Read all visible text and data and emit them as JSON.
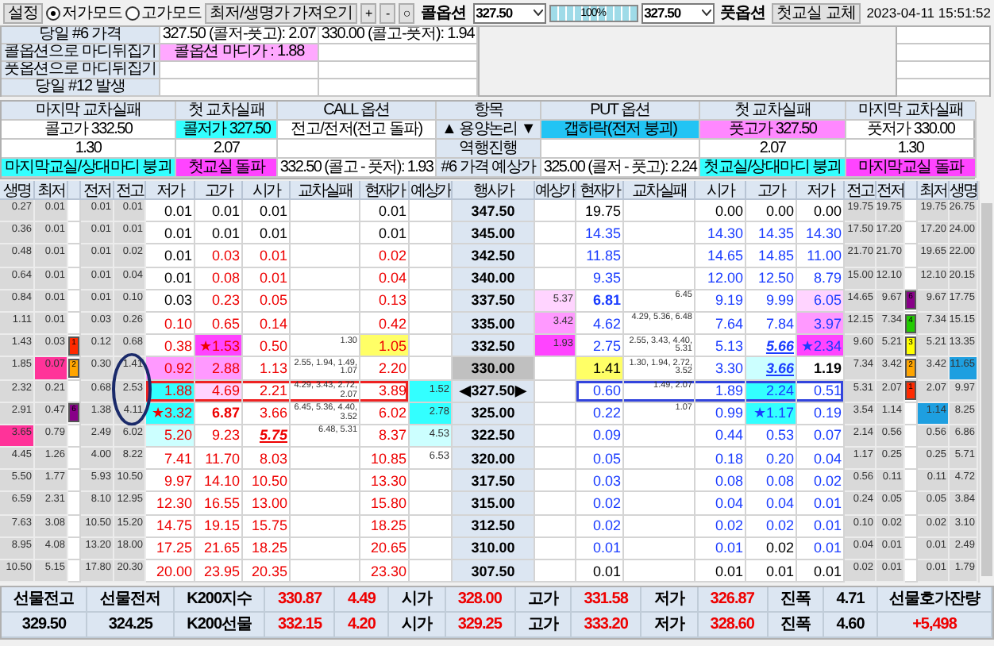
{
  "toolbar": {
    "settings_button": "설정",
    "modes": [
      {
        "label": "저가모드",
        "selected": true
      },
      {
        "label": "고가모드",
        "selected": false
      }
    ],
    "fetch_button": "최저/생명가 가져오기",
    "small_buttons": [
      "+",
      "-",
      "○"
    ],
    "call_label": "콜옵션",
    "call_select": "327.50",
    "progress": {
      "label": "100%",
      "level": 1.0
    },
    "put_select": "327.50",
    "put_label": "풋옵션",
    "swap_button": "첫교실 교체",
    "datetime": "2023-04-11 15:51:52"
  },
  "info": {
    "rows": [
      [
        "당일 #6 가격",
        "327.50 (콜저-풋고): 2.07",
        "330.00 (콜고-풋저): 1.94"
      ],
      [
        "콜옵션으로 마디뒤집기",
        {
          "text": "콜옵션 마디가 : 1.88",
          "color": "#ffa8ff"
        },
        null
      ],
      [
        "풋옵션으로 마디뒤집기",
        null,
        null
      ],
      [
        "당일 #12 발생",
        null,
        null
      ]
    ]
  },
  "summary": {
    "headers": [
      "마지막 교차실패",
      "첫 교차실패",
      "CALL 옵션",
      "항목",
      "PUT 옵션",
      "첫 교차실패",
      "마지막 교차실패"
    ],
    "rows": [
      [
        "콜고가 332.50",
        {
          "text": "콜저가 327.50",
          "color": "#33ffff"
        },
        "전고/전저(전고 돌파)",
        "▲ 용양논리 ▼",
        {
          "text": "갭하락(전저 붕괴)",
          "color": "#22c4f4"
        },
        {
          "text": "풋고가 327.50",
          "color": "#ff88ff"
        },
        "풋저가 330.00"
      ],
      [
        "1.30",
        "2.07",
        null,
        "역행진행",
        null,
        "2.07",
        "1.30"
      ],
      [
        {
          "text": "마지막교실/상대마디 붕괴",
          "color": "#33ffff"
        },
        {
          "text": "첫교실 돌파",
          "color": "#ff44ff"
        },
        "332.50 (콜고 - 풋저): 1.93",
        "#6 가격 예상가",
        "325.00 (콜저 - 풋고): 2.24",
        {
          "text": "첫교실/상대마디 붕괴",
          "color": "#33ffff"
        },
        {
          "text": "마지막교실 돌파",
          "color": "#ff44ff"
        }
      ]
    ]
  },
  "table": {
    "call_headers": [
      "생명",
      "최저",
      "전저",
      "전고",
      "저가",
      "고가",
      "시가",
      "교차실패",
      "현재가",
      "예상가"
    ],
    "strike_header": "행사가",
    "put_headers": [
      "예상가",
      "현재가",
      "교차실패",
      "시가",
      "고가",
      "저가",
      "전고",
      "전저",
      "최저",
      "생명"
    ],
    "rows": [
      {
        "strike": "347.50",
        "atm": false,
        "current": false,
        "call": {
          "life": "0.27",
          "low": "0.01",
          "prev_low": "0.01",
          "prev_high": "0.01",
          "day_low": {
            "text": "0.01",
            "unchanged": true
          },
          "day_high": {
            "text": "0.01",
            "unchanged": true
          },
          "open": {
            "text": "0.01",
            "unchanged": true
          },
          "price": {
            "text": "0.01",
            "unchanged": true
          }
        },
        "put": {
          "price": {
            "text": "19.75",
            "unchanged": true
          },
          "open": {
            "text": "0.00",
            "unchanged": true
          },
          "day_high": {
            "text": "0.00",
            "unchanged": true
          },
          "day_low": {
            "text": "0.00",
            "unchanged": true
          },
          "prev_high": "19.75",
          "prev_low": "19.75",
          "low": "19.75",
          "life": "26.75"
        }
      },
      {
        "strike": "345.00",
        "atm": false,
        "current": false,
        "call": {
          "life": "0.36",
          "low": "0.01",
          "prev_low": "0.01",
          "prev_high": "0.01",
          "day_low": {
            "text": "0.01",
            "unchanged": true
          },
          "day_high": {
            "text": "0.01",
            "unchanged": true
          },
          "open": {
            "text": "0.01",
            "unchanged": true
          },
          "price": {
            "text": "0.01",
            "unchanged": true
          }
        },
        "put": {
          "price": "14.35",
          "open": "14.30",
          "day_high": "14.35",
          "day_low": "14.30",
          "prev_high": "17.50",
          "prev_low": "17.20",
          "low": "17.20",
          "life": "24.00"
        }
      },
      {
        "strike": "342.50",
        "atm": false,
        "current": false,
        "call": {
          "life": "0.48",
          "low": "0.01",
          "prev_low": "0.01",
          "prev_high": "0.02",
          "day_low": {
            "text": "0.01",
            "unchanged": true
          },
          "day_high": "0.03",
          "open": "0.01",
          "price": "0.02"
        },
        "put": {
          "price": "11.85",
          "open": "14.65",
          "day_high": "14.85",
          "day_low": "11.00",
          "prev_high": "21.70",
          "prev_low": "21.70",
          "low": "19.65",
          "life": "22.00"
        }
      },
      {
        "strike": "340.00",
        "atm": false,
        "current": false,
        "call": {
          "life": "0.64",
          "low": "0.01",
          "prev_low": "0.01",
          "prev_high": "0.04",
          "day_low": {
            "text": "0.01",
            "unchanged": true
          },
          "day_high": "0.08",
          "open": "0.01",
          "price": "0.04"
        },
        "put": {
          "price": "9.35",
          "open": "12.00",
          "day_high": "12.50",
          "day_low": "8.79",
          "prev_high": "15.00",
          "prev_low": "12.10",
          "low": "12.10",
          "life": "20.15"
        }
      },
      {
        "strike": "337.50",
        "atm": false,
        "current": false,
        "call": {
          "life": "0.84",
          "low": "0.01",
          "prev_low": "0.01",
          "prev_high": "0.10",
          "day_low": {
            "text": "0.03",
            "unchanged": true
          },
          "day_high": "0.23",
          "open": "0.05",
          "price": "0.13"
        },
        "put": {
          "expected": {
            "text": "5.37",
            "color": "#ffd4ff"
          },
          "price": {
            "text": "6.81",
            "bold": true
          },
          "cross_fail": "6.45",
          "open": "9.19",
          "day_high": "9.99",
          "day_low": {
            "text": "6.05",
            "color": "#ffd4ff"
          },
          "prev_high": "14.65",
          "prev_low": "9.67",
          "marker": {
            "text": "6",
            "color": "#880088"
          },
          "low": "9.67",
          "life": "17.75"
        }
      },
      {
        "strike": "335.00",
        "atm": false,
        "current": false,
        "call": {
          "life": "1.11",
          "low": "0.01",
          "prev_low": "0.03",
          "prev_high": "0.26",
          "day_low": "0.10",
          "day_high": "0.65",
          "open": "0.14",
          "price": "0.42"
        },
        "put": {
          "expected": {
            "text": "3.42",
            "color": "#ff99ff"
          },
          "price": "4.62",
          "cross_fail": "4.29, 5.36, 6.48",
          "open": "7.64",
          "day_high": "7.84",
          "day_low": {
            "text": "3.97",
            "color": "#ff99ff"
          },
          "prev_high": "12.15",
          "prev_low": "7.34",
          "marker": {
            "text": "4",
            "color": "#22cc00"
          },
          "low": "7.34",
          "life": "15.15"
        }
      },
      {
        "strike": "332.50",
        "atm": false,
        "current": false,
        "call": {
          "life": "1.43",
          "low": "0.03",
          "marker": {
            "text": "1",
            "color": "#ff2a00"
          },
          "prev_low": "0.12",
          "prev_high": "0.68",
          "day_low": "0.38",
          "day_high": {
            "text": "★1.53",
            "color": "#ff44ff"
          },
          "open": "0.50",
          "cross_fail": "1.30",
          "price": {
            "text": "1.05",
            "color": "#ffff66"
          }
        },
        "put": {
          "expected": {
            "text": "1.93",
            "color": "#ff44ff"
          },
          "price": "2.75",
          "cross_fail": "2.55, 3.43, 4.40, 5.31",
          "open": "5.13",
          "day_high": {
            "text": "5.66",
            "emph": true
          },
          "day_low": {
            "text": "★2.34",
            "color": "#ff44ff"
          },
          "prev_high": "9.60",
          "prev_low": "5.21",
          "marker": {
            "text": "3",
            "color": "#ffff00"
          },
          "low": "5.21",
          "life": "13.35"
        }
      },
      {
        "strike": "330.00",
        "atm": true,
        "current": false,
        "call": {
          "life": "1.85",
          "low": {
            "text": "0.07",
            "color": "#ff3399"
          },
          "marker": {
            "text": "2",
            "color": "#ffa500"
          },
          "prev_low": "0.30",
          "prev_high": "1.41",
          "day_low": {
            "text": "0.92",
            "color": "#ff99ff"
          },
          "day_high": {
            "text": "2.88",
            "color": "#ff99ff"
          },
          "open": "1.13",
          "cross_fail": "2.55, 1.94, 1.49, 1.07",
          "price": "2.20"
        },
        "put": {
          "price": {
            "text": "1.41",
            "color": "#ffff66",
            "unchanged": true
          },
          "cross_fail": "1.30, 1.94, 2.72, 3.52",
          "open": "3.30",
          "day_high": {
            "text": "3.66",
            "color": "#ccffff",
            "emph": true
          },
          "day_low": {
            "text": "1.19",
            "unchanged": true,
            "bold": true
          },
          "prev_high": "7.34",
          "prev_low": "3.42",
          "marker": {
            "text": "2",
            "color": "#ffa500"
          },
          "low": "3.42",
          "life": {
            "text": "11.65",
            "color": "#1e9fe0"
          }
        }
      },
      {
        "strike": "◀327.50▶",
        "atm": false,
        "current": true,
        "call": {
          "life": "2.32",
          "low": "0.21",
          "prev_low": "0.68",
          "prev_high": "2.53",
          "day_low": {
            "text": "1.88",
            "color": "#33ffff"
          },
          "day_high": {
            "text": "4.69",
            "color": "#ffd4ff"
          },
          "open": "2.21",
          "cross_fail": "4.29, 3.43, 2.72, 2.07",
          "price": "3.89",
          "expected": {
            "text": "1.52",
            "color": "#33ffff"
          }
        },
        "put": {
          "price": "0.60",
          "cross_fail": "1.49, 2.07",
          "open": "1.89",
          "day_high": {
            "text": "2.24",
            "color": "#33ffff"
          },
          "day_low": "0.51",
          "prev_high": "5.31",
          "prev_low": "2.07",
          "marker": {
            "text": "1",
            "color": "#ff2a00"
          },
          "low": "2.07",
          "life": "9.97"
        }
      },
      {
        "strike": "325.00",
        "atm": false,
        "current": false,
        "call": {
          "life": "2.91",
          "low": "0.47",
          "marker": {
            "text": "6",
            "color": "#880088"
          },
          "prev_low": "1.38",
          "prev_high": "4.11",
          "day_low": {
            "text": "★3.32",
            "color": "#33ffff"
          },
          "day_high": {
            "text": "6.87",
            "bold": true
          },
          "open": "3.66",
          "cross_fail": "6.45, 5.36, 4.40, 3.52",
          "price": "6.02",
          "expected": {
            "text": "2.78",
            "color": "#33ffff"
          }
        },
        "put": {
          "price": "0.22",
          "cross_fail": "1.07",
          "open": "0.99",
          "day_high": {
            "text": "★1.17",
            "color": "#33ffff"
          },
          "day_low": "0.19",
          "prev_high": "3.54",
          "prev_low": "1.14",
          "low": {
            "text": "1.14",
            "color": "#1e9fe0"
          },
          "life": "8.25"
        }
      },
      {
        "strike": "322.50",
        "atm": false,
        "current": false,
        "call": {
          "life": {
            "text": "3.65",
            "color": "#ff3399"
          },
          "low": "0.79",
          "prev_low": "2.49",
          "prev_high": "6.02",
          "day_low": {
            "text": "5.20",
            "color": "#ccffff"
          },
          "day_high": "9.23",
          "open": {
            "text": "5.75",
            "emph": true
          },
          "cross_fail": "6.48, 5.31",
          "price": "8.37",
          "expected": {
            "text": "4.53",
            "color": "#ccffff"
          }
        },
        "put": {
          "price": "0.09",
          "open": "0.44",
          "day_high": "0.53",
          "day_low": "0.07",
          "prev_high": "2.14",
          "prev_low": "0.56",
          "low": "0.56",
          "life": "6.86"
        }
      },
      {
        "strike": "320.00",
        "atm": false,
        "current": false,
        "call": {
          "life": "4.45",
          "low": "1.26",
          "prev_low": "4.00",
          "prev_high": "8.22",
          "day_low": "7.41",
          "day_high": "11.70",
          "open": "8.03",
          "price": "10.85",
          "expected": "6.53"
        },
        "put": {
          "price": "0.05",
          "open": "0.18",
          "day_high": "0.20",
          "day_low": "0.04",
          "prev_high": "1.17",
          "prev_low": "0.25",
          "low": "0.25",
          "life": "5.71"
        }
      },
      {
        "strike": "317.50",
        "atm": false,
        "current": false,
        "call": {
          "life": "5.50",
          "low": "1.77",
          "prev_low": "5.93",
          "prev_high": "10.50",
          "day_low": "9.97",
          "day_high": "14.10",
          "open": "10.50",
          "price": "13.30"
        },
        "put": {
          "price": "0.03",
          "open": "0.08",
          "day_high": "0.08",
          "day_low": "0.02",
          "prev_high": "0.56",
          "prev_low": "0.11",
          "low": "0.11",
          "life": "4.72"
        }
      },
      {
        "strike": "315.00",
        "atm": false,
        "current": false,
        "call": {
          "life": "6.59",
          "low": "2.31",
          "prev_low": "8.10",
          "prev_high": "12.95",
          "day_low": "12.30",
          "day_high": "16.55",
          "open": "13.00",
          "price": "15.80"
        },
        "put": {
          "price": "0.02",
          "open": "0.04",
          "day_high": "0.04",
          "day_low": "0.01",
          "prev_high": "0.24",
          "prev_low": "0.05",
          "low": "0.05",
          "life": "3.84"
        }
      },
      {
        "strike": "312.50",
        "atm": false,
        "current": false,
        "call": {
          "life": "7.63",
          "low": "3.08",
          "prev_low": "10.50",
          "prev_high": "15.20",
          "day_low": "14.75",
          "day_high": "19.15",
          "open": "15.75",
          "price": "18.25"
        },
        "put": {
          "price": "0.02",
          "open": "0.02",
          "day_high": "0.02",
          "day_low": "0.01",
          "prev_high": "0.10",
          "prev_low": "0.02",
          "low": "0.02",
          "life": "3.10"
        }
      },
      {
        "strike": "310.00",
        "atm": false,
        "current": false,
        "call": {
          "life": "8.95",
          "low": "4.08",
          "prev_low": "13.20",
          "prev_high": "18.00",
          "day_low": "17.25",
          "day_high": "21.65",
          "open": "18.25",
          "price": "20.65"
        },
        "put": {
          "price": "0.01",
          "open": "0.01",
          "day_high": {
            "text": "0.02",
            "unchanged": true
          },
          "day_low": "0.01",
          "prev_high": "0.04",
          "prev_low": "0.01",
          "low": "0.01",
          "life": "2.49"
        }
      },
      {
        "strike": "307.50",
        "atm": false,
        "current": false,
        "call": {
          "life": "10.50",
          "low": "5.15",
          "prev_low": "17.80",
          "prev_high": "20.30",
          "day_low": "20.00",
          "day_high": "23.95",
          "open": "20.35",
          "price": "23.30"
        },
        "put": {
          "price": {
            "text": "0.01",
            "unchanged": true
          },
          "open": {
            "text": "0.01",
            "unchanged": true
          },
          "day_high": {
            "text": "0.01",
            "unchanged": true
          },
          "day_low": {
            "text": "0.01",
            "unchanged": true
          },
          "prev_high": "0.02",
          "prev_low": "0.01",
          "low": "0.01",
          "life": "1.79"
        }
      }
    ]
  },
  "footer": {
    "rows": [
      [
        "선물전고",
        "선물전저",
        "K200지수",
        {
          "text": "330.87",
          "up": true
        },
        {
          "text": "4.49",
          "up": true
        },
        "시가",
        {
          "text": "328.00",
          "up": true
        },
        "고가",
        {
          "text": "331.58",
          "up": true
        },
        "저가",
        {
          "text": "326.87",
          "up": true
        },
        "진폭",
        {
          "text": "4.71",
          "up": false
        },
        "선물호가잔량"
      ],
      [
        {
          "text": "329.50",
          "up": false
        },
        {
          "text": "324.25",
          "up": false
        },
        "K200선물",
        {
          "text": "332.15",
          "up": true
        },
        {
          "text": "4.20",
          "up": true
        },
        "시가",
        {
          "text": "329.25",
          "up": true
        },
        "고가",
        {
          "text": "333.20",
          "up": true
        },
        "저가",
        {
          "text": "328.60",
          "up": true
        },
        "진폭",
        {
          "text": "4.60",
          "up": false
        },
        {
          "text": "+5,498",
          "up": true
        }
      ]
    ]
  }
}
